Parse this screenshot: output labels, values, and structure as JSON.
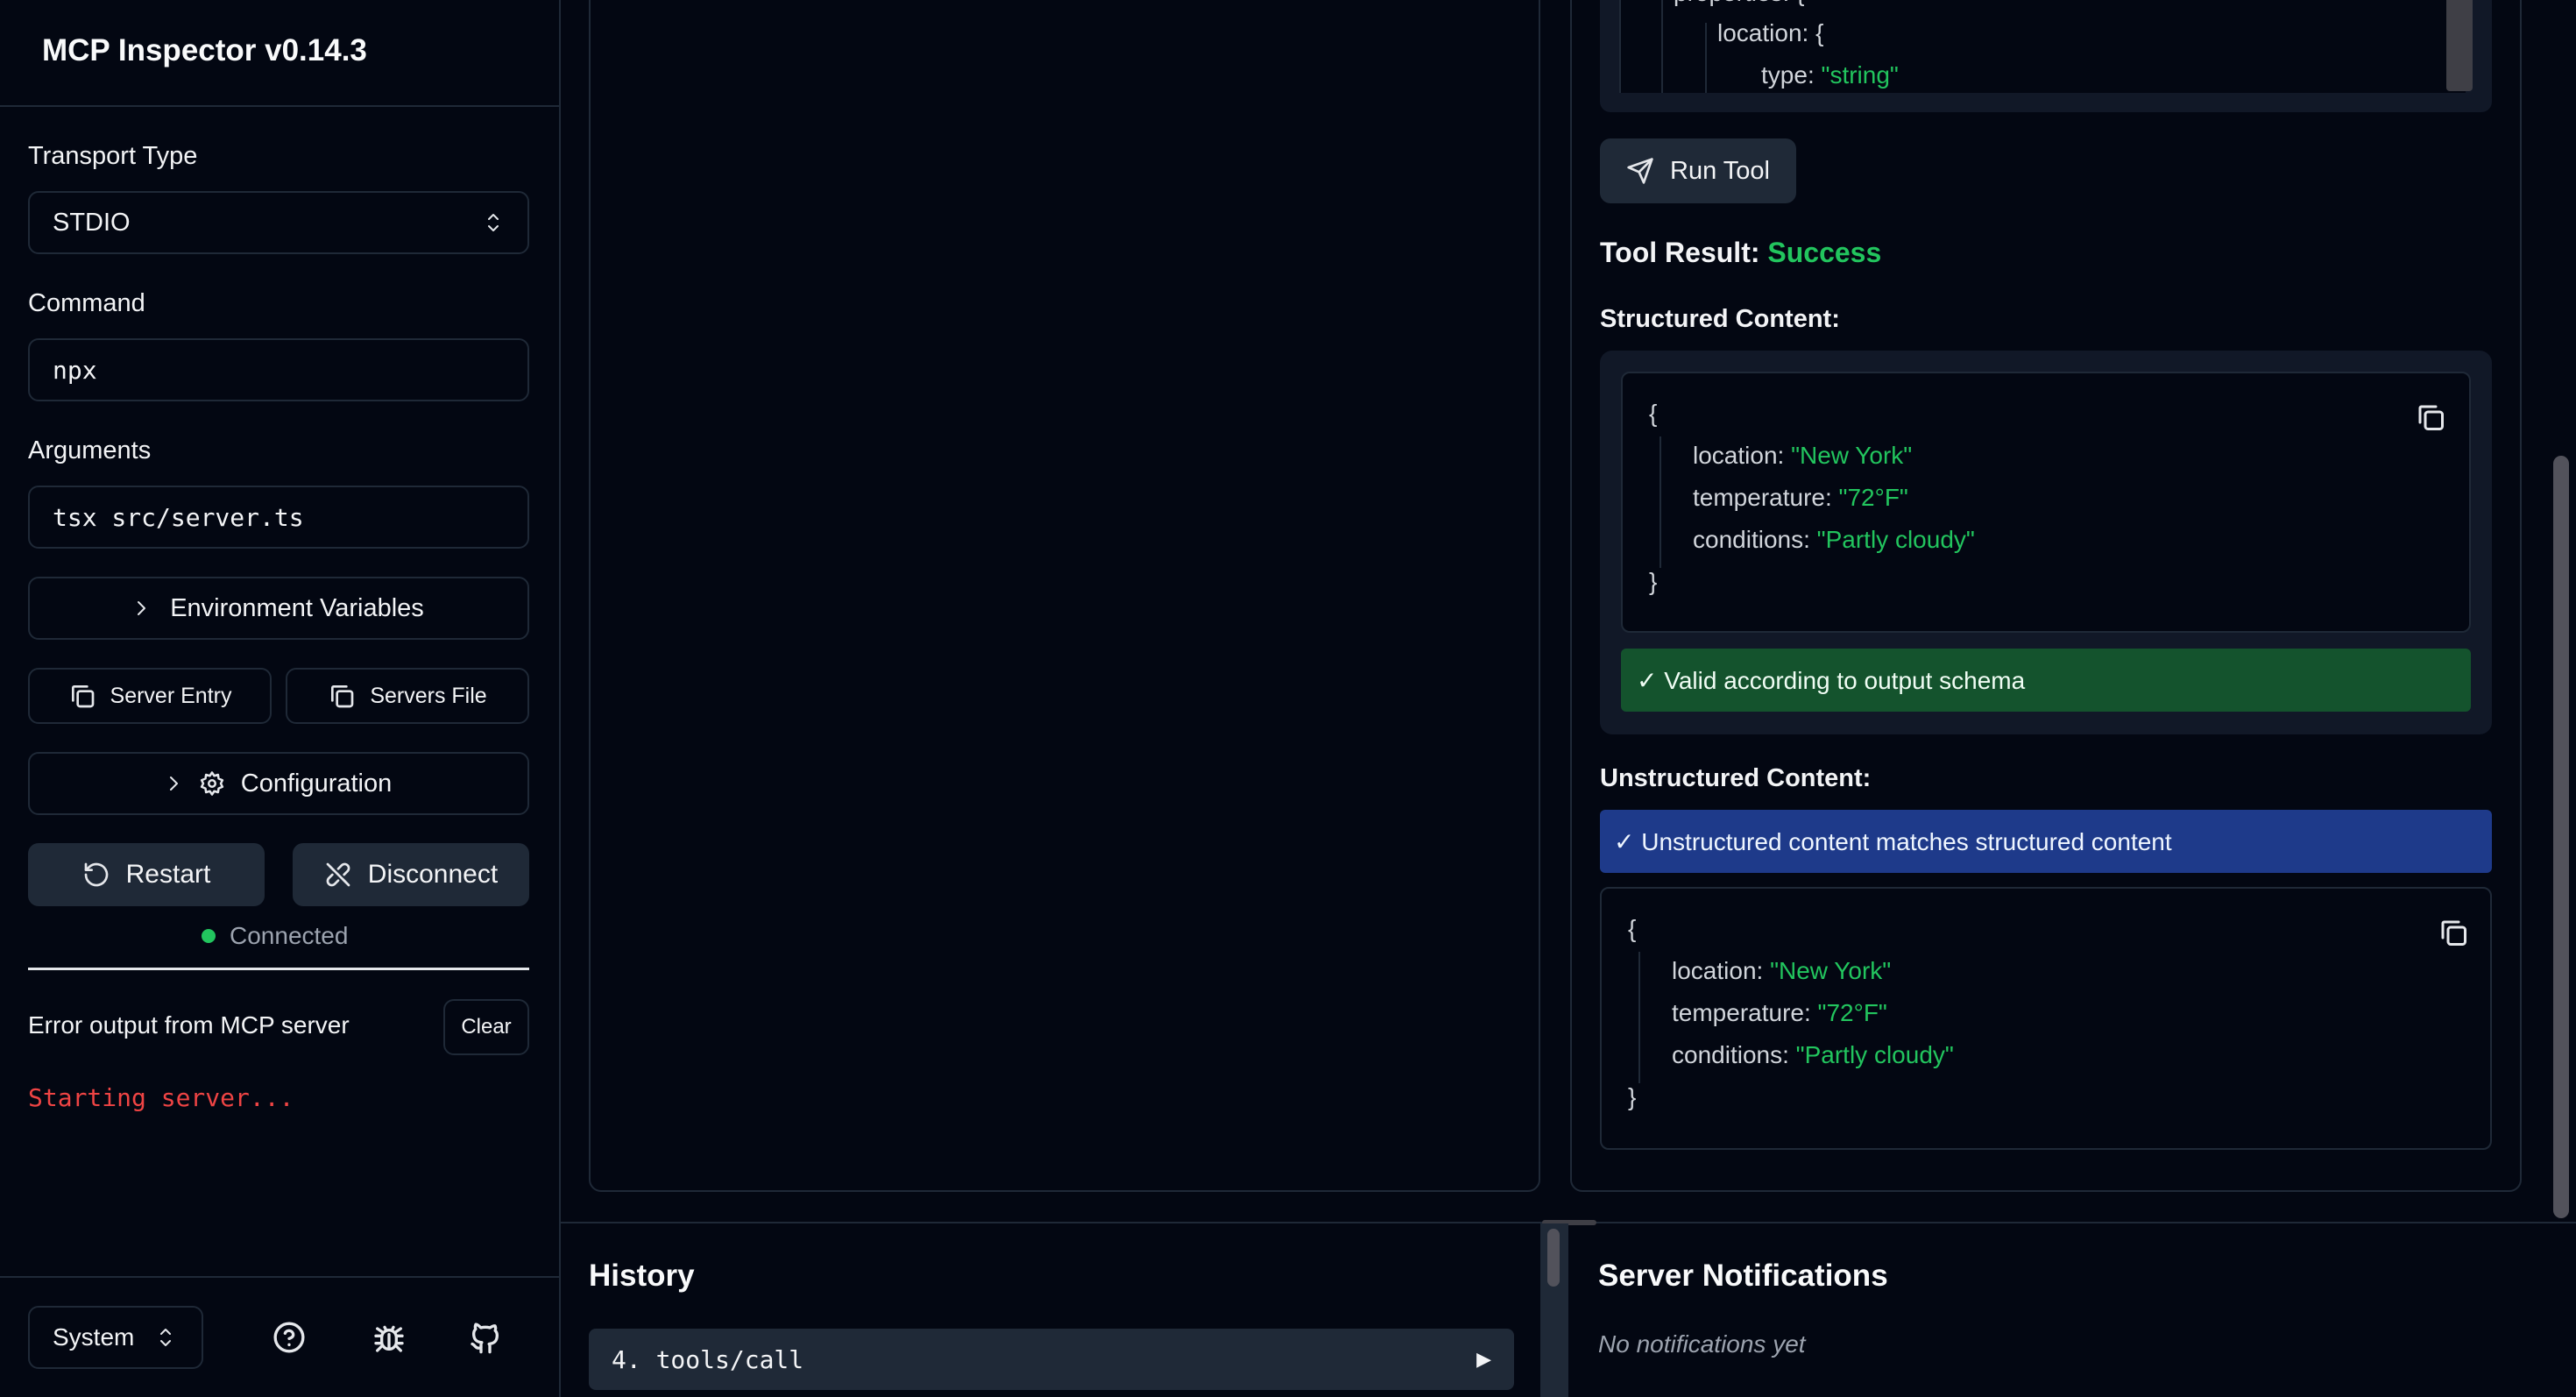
{
  "sidebar": {
    "app_title": "MCP Inspector v0.14.3",
    "transport_label": "Transport Type",
    "transport_value": "STDIO",
    "command_label": "Command",
    "command_value": "npx",
    "arguments_label": "Arguments",
    "arguments_value": "tsx src/server.ts",
    "env_vars_label": "Environment Variables",
    "server_entry_label": "Server Entry",
    "servers_file_label": "Servers File",
    "configuration_label": "Configuration",
    "restart_label": "Restart",
    "disconnect_label": "Disconnect",
    "status_text": "Connected",
    "error_output_label": "Error output from MCP server",
    "clear_label": "Clear",
    "error_log": "Starting server...",
    "theme_value": "System",
    "colors": {
      "connected": "#22c55e",
      "error_text": "#ef4444"
    }
  },
  "tool_panel": {
    "schema_lines": [
      {
        "key": "properties",
        "punct": ": {"
      },
      {
        "key": "location",
        "punct": ": {"
      },
      {
        "key": "type",
        "punct": ": ",
        "str": "\"string\""
      }
    ],
    "run_tool_label": "Run Tool",
    "result_label": "Tool Result:",
    "result_status": "Success",
    "structured_label": "Structured Content:",
    "structured": {
      "open": "{",
      "close": "}",
      "fields": [
        {
          "key": "location",
          "value": "\"New York\""
        },
        {
          "key": "temperature",
          "value": "\"72°F\""
        },
        {
          "key": "conditions",
          "value": "\"Partly cloudy\""
        }
      ]
    },
    "valid_msg": "✓ Valid according to output schema",
    "unstructured_label": "Unstructured Content:",
    "match_msg": "✓ Unstructured content matches structured content",
    "unstructured": {
      "open": "{",
      "close": "}",
      "fields": [
        {
          "key": "location",
          "value": "\"New York\""
        },
        {
          "key": "temperature",
          "value": "\"72°F\""
        },
        {
          "key": "conditions",
          "value": "\"Partly cloudy\""
        }
      ]
    },
    "colors": {
      "success": "#22c55e",
      "valid_bg": "#14532d",
      "match_bg": "#1e3a8a"
    }
  },
  "history": {
    "title": "History",
    "items": [
      {
        "label": "4. tools/call"
      }
    ]
  },
  "notifications": {
    "title": "Server Notifications",
    "empty_text": "No notifications yet"
  }
}
